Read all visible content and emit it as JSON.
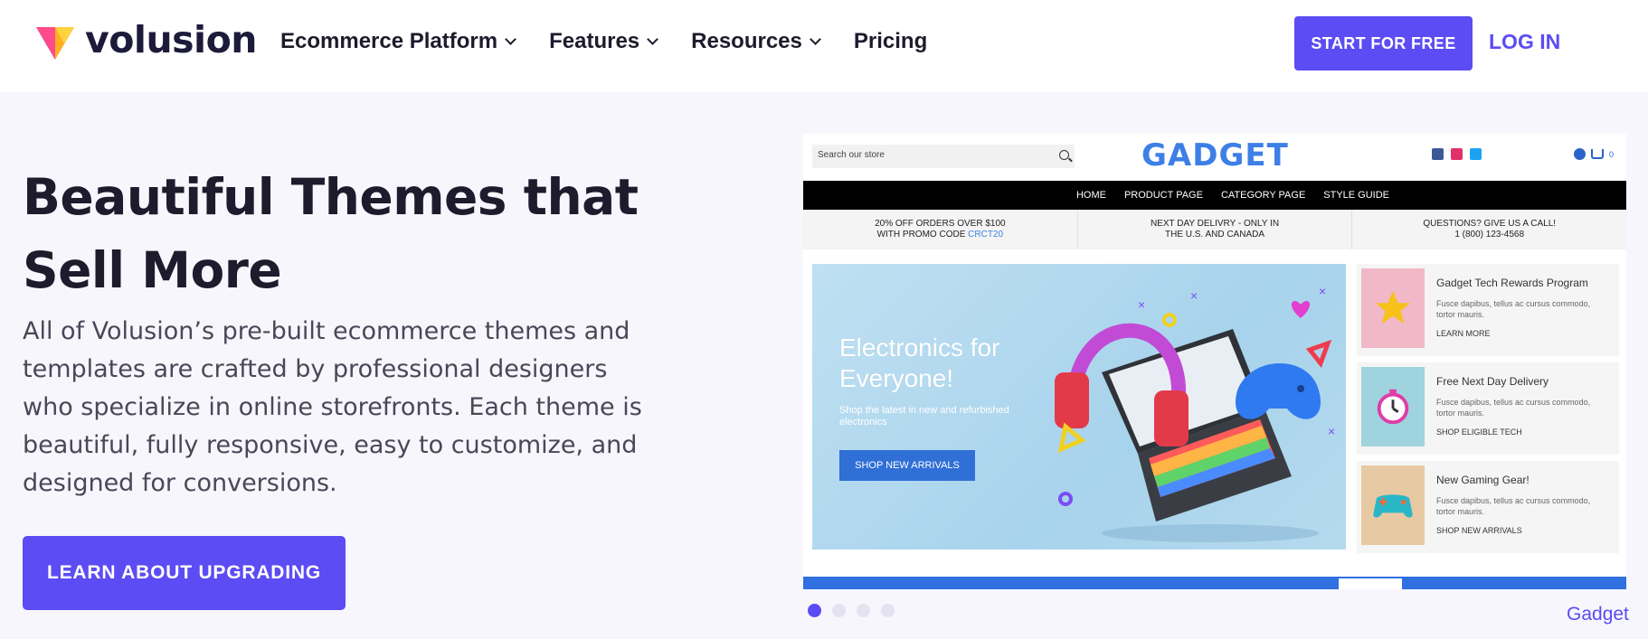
{
  "nav": {
    "brand": "volusion",
    "menu": [
      "Ecommerce Platform",
      "Features",
      "Resources",
      "Pricing"
    ],
    "cta_start": "START FOR FREE",
    "cta_login": "LOG IN"
  },
  "hero": {
    "title_line1": "Beautiful Themes that",
    "title_line2": "Sell More",
    "body": "All of Volusion’s pre-built ecommerce themes and templates are crafted by professional designers who specialize in online storefronts. Each theme is beautiful, fully responsive, easy to customize, and designed for conversions.",
    "button": "LEARN ABOUT UPGRADING"
  },
  "store_preview": {
    "search_placeholder": "Search our store",
    "brand": "GADGET",
    "cart_count": "0",
    "nav": [
      "HOME",
      "PRODUCT PAGE",
      "CATEGORY PAGE",
      "STYLE GUIDE"
    ],
    "promos": [
      {
        "line1": "20% OFF ORDERS OVER $100",
        "line2": "WITH PROMO CODE ",
        "code": "CRCT20"
      },
      {
        "line1": "NEXT DAY DELIVRY - ONLY IN",
        "line2": "THE U.S. AND CANADA",
        "code": ""
      },
      {
        "line1": "QUESTIONS? GIVE US A CALL!",
        "line2": "1 (800) 123-4568",
        "code": ""
      }
    ],
    "banner": {
      "title": "Electronics for Everyone!",
      "subtitle": "Shop the latest in new and refurbished electronics",
      "button": "SHOP NEW ARRIVALS"
    },
    "cards": [
      {
        "title": "Gadget Tech Rewards Program",
        "text": "Fusce dapibus, tellus ac cursus commodo, tortor mauris.",
        "link": "LEARN MORE",
        "color": "#f1b8c8"
      },
      {
        "title": "Free Next Day Delivery",
        "text": "Fusce dapibus, tellus ac cursus commodo, tortor mauris.",
        "link": "SHOP ELIGIBLE TECH",
        "color": "#9fd3de"
      },
      {
        "title": "New Gaming Gear!",
        "text": "Fusce dapibus, tellus ac cursus commodo, tortor mauris.",
        "link": "SHOP NEW ARRIVALS",
        "color": "#e7c9a4"
      }
    ]
  },
  "carousel": {
    "caption": "Gadget",
    "active_index": 0,
    "count": 4
  },
  "colors": {
    "accent": "#5b4cf4",
    "store_blue": "#3d7fe6"
  }
}
